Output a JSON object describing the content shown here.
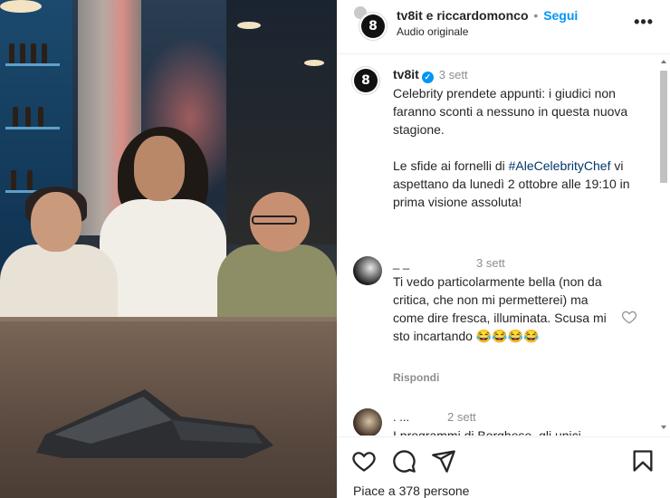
{
  "header": {
    "username": "tv8it e riccardomonco",
    "separator": "•",
    "follow_label": "Segui",
    "audio": "Audio originale",
    "avatar_letters": "8",
    "more_icon": "more-horizontal-icon",
    "more_glyph": "•••"
  },
  "caption": {
    "username": "tv8it",
    "verified_glyph": "✓",
    "time": "3 sett",
    "text_part1": "Celebrity prendete appunti: i giudici non faranno sconti a nessuno in questa nuova stagione.\n\nLe sfide ai fornelli di ",
    "hashtag": "#AleCelebrityChef",
    "text_part2": " vi aspettano da lunedì 2 ottobre alle 19:10 in prima visione assoluta!"
  },
  "comments": [
    {
      "username": "_ _",
      "time": "3 sett",
      "text": "Ti vedo particolarmente bella (non da critica, che non mi permetterei) ma come dire fresca, illuminata. Scusa mi sto incartando 😂😂😂😂",
      "reply_label": "Rispondi"
    },
    {
      "username": ". ...",
      "time": "2 sett",
      "text": "I programmi di Borghese, gli unici"
    }
  ],
  "actions": {
    "like_icon": "heart-icon",
    "comment_icon": "comment-icon",
    "share_icon": "send-icon",
    "save_icon": "bookmark-icon"
  },
  "likes_text": "Piace a 378 persone",
  "colors": {
    "follow": "#0095f6",
    "hashtag": "#00376b",
    "secondary": "#8e8e8e"
  }
}
